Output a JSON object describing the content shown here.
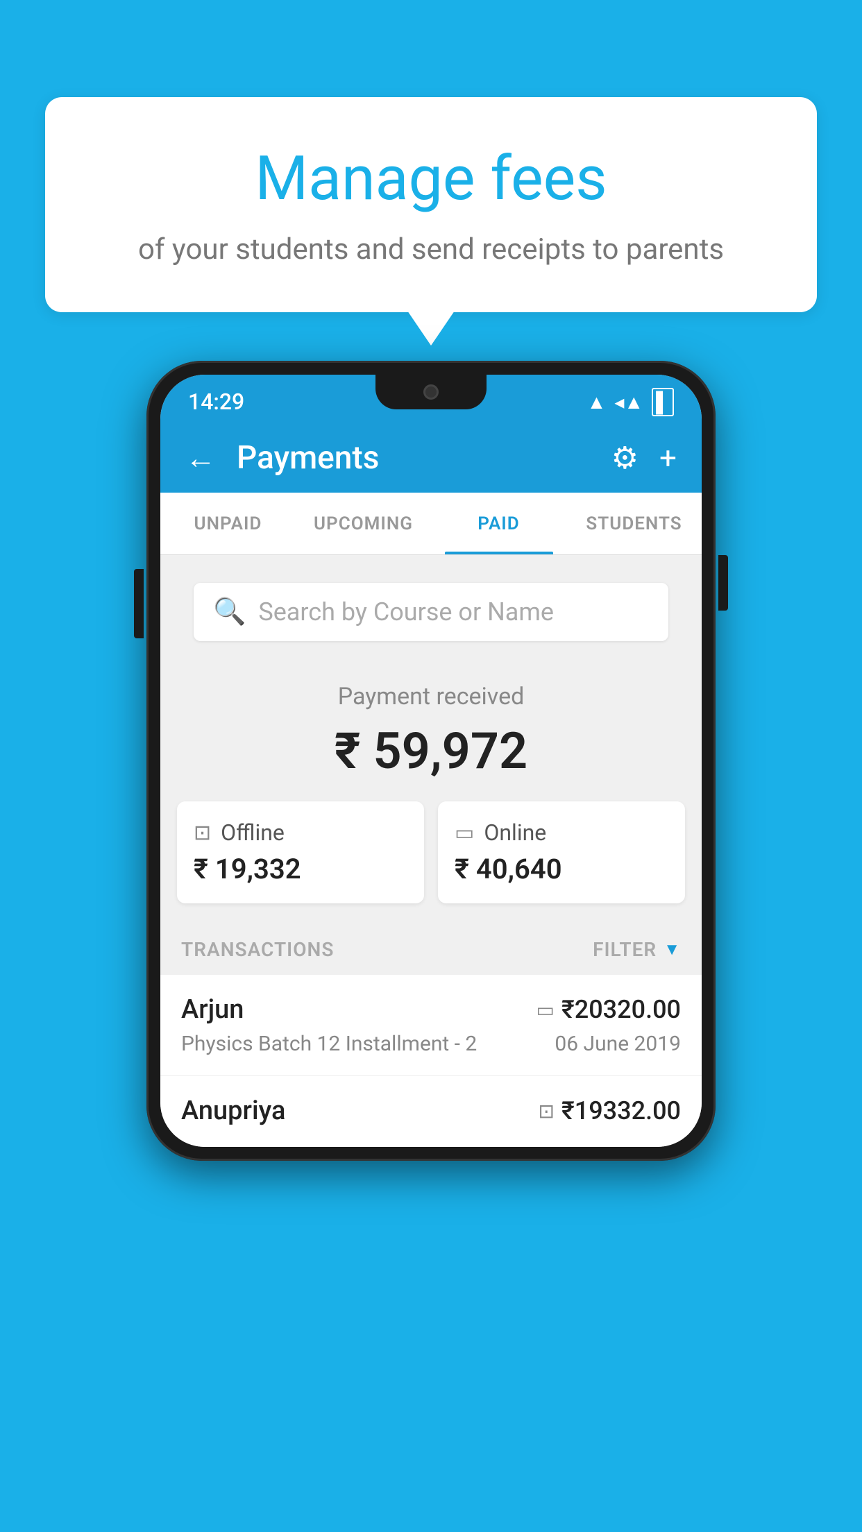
{
  "background_color": "#1ab0e8",
  "bubble": {
    "title": "Manage fees",
    "subtitle": "of your students and send receipts to parents"
  },
  "status_bar": {
    "time": "14:29",
    "wifi": "▲",
    "signal": "▲",
    "battery": "▌"
  },
  "app_bar": {
    "title": "Payments",
    "back_icon": "←",
    "settings_icon": "⚙",
    "add_icon": "+"
  },
  "tabs": [
    {
      "label": "UNPAID",
      "active": false
    },
    {
      "label": "UPCOMING",
      "active": false
    },
    {
      "label": "PAID",
      "active": true
    },
    {
      "label": "STUDENTS",
      "active": false
    }
  ],
  "search": {
    "placeholder": "Search by Course or Name"
  },
  "payment_summary": {
    "label": "Payment received",
    "amount": "₹ 59,972",
    "offline": {
      "label": "Offline",
      "amount": "₹ 19,332"
    },
    "online": {
      "label": "Online",
      "amount": "₹ 40,640"
    }
  },
  "transactions": {
    "header_label": "TRANSACTIONS",
    "filter_label": "FILTER",
    "rows": [
      {
        "name": "Arjun",
        "detail": "Physics Batch 12 Installment - 2",
        "amount": "₹20320.00",
        "date": "06 June 2019",
        "type": "online"
      },
      {
        "name": "Anupriya",
        "detail": "",
        "amount": "₹19332.00",
        "date": "",
        "type": "offline"
      }
    ]
  }
}
